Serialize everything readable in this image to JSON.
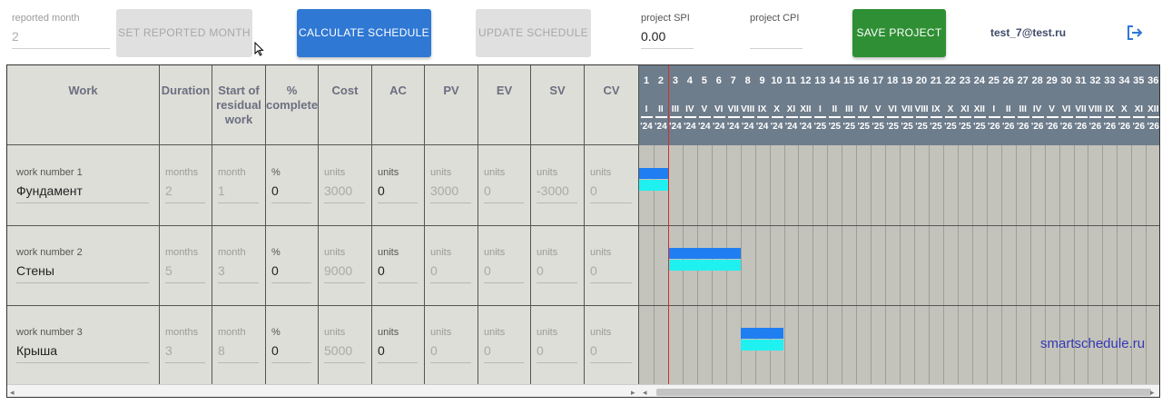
{
  "toolbar": {
    "reported_month_label": "reported month",
    "reported_month_value": "2",
    "set_reported_month": "SET REPORTED MONTH",
    "calculate_schedule": "CALCULATE SCHEDULE",
    "update_schedule": "UPDATE SCHEDULE",
    "spi_label": "project SPI",
    "spi_value": "0.00",
    "cpi_label": "project CPI",
    "cpi_value": "",
    "save_project": "SAVE PROJECT",
    "user_email": "test_7@test.ru"
  },
  "columns": {
    "work": "Work",
    "duration": "Duration",
    "start": "Start of residual work",
    "complete": "% complete",
    "cost": "Cost",
    "ac": "AC",
    "pv": "PV",
    "ev": "EV",
    "sv": "SV",
    "cv": "CV"
  },
  "units": {
    "months": "months",
    "month": "month",
    "percent": "%",
    "units": "units"
  },
  "rows": [
    {
      "label": "work number 1",
      "name": "Фундамент",
      "duration": "2",
      "start": "1",
      "complete": "0",
      "cost": "3000",
      "ac": "0",
      "pv": "3000",
      "ev": "0",
      "sv": "-3000",
      "cv": "0",
      "bar_start": 0,
      "bar_len": 2
    },
    {
      "label": "work number 2",
      "name": "Стены",
      "duration": "5",
      "start": "3",
      "complete": "0",
      "cost": "9000",
      "ac": "0",
      "pv": "0",
      "ev": "0",
      "sv": "0",
      "cv": "0",
      "bar_start": 2,
      "bar_len": 5
    },
    {
      "label": "work number 3",
      "name": "Крыша",
      "duration": "3",
      "start": "8",
      "complete": "0",
      "cost": "5000",
      "ac": "0",
      "pv": "0",
      "ev": "0",
      "sv": "0",
      "cv": "0",
      "bar_start": 7,
      "bar_len": 3
    }
  ],
  "timeline": {
    "months": [
      "1",
      "2",
      "3",
      "4",
      "5",
      "6",
      "7",
      "8",
      "9",
      "10",
      "11",
      "12",
      "13",
      "14",
      "15",
      "16",
      "17",
      "18",
      "19",
      "20",
      "21",
      "22",
      "23",
      "24",
      "25",
      "26",
      "27",
      "28",
      "29",
      "30",
      "31",
      "32",
      "33",
      "34",
      "35",
      "36"
    ],
    "roman": [
      "I",
      "II",
      "III",
      "IV",
      "V",
      "VI",
      "VII",
      "VIII",
      "IX",
      "X",
      "XI",
      "XII",
      "I",
      "II",
      "III",
      "IV",
      "V",
      "VI",
      "VII",
      "VIII",
      "IX",
      "X",
      "XI",
      "XII",
      "I",
      "II",
      "III",
      "IV",
      "V",
      "VI",
      "VII",
      "VIII",
      "IX",
      "X",
      "XI",
      "XII"
    ],
    "years": [
      "'24",
      "'24",
      "'24",
      "'24",
      "'24",
      "'24",
      "'24",
      "'24",
      "'24",
      "'24",
      "'24",
      "'24",
      "'25",
      "'25",
      "'25",
      "'25",
      "'25",
      "'25",
      "'25",
      "'25",
      "'25",
      "'25",
      "'25",
      "'25",
      "'26",
      "'26",
      "'26",
      "'26",
      "'26",
      "'26",
      "'26",
      "'26",
      "'26",
      "'26",
      "'26",
      "'26"
    ]
  },
  "watermark": "smartschedule.ru",
  "colors": {
    "plan_bar": "#1e7ef2",
    "actual_bar": "#1ff0f0",
    "button_blue": "#2f78d4",
    "button_green": "#2f8f34",
    "gantt_header": "#6e7d8c"
  },
  "icons": {
    "logout": "logout-icon",
    "cursor": "mouse-cursor"
  }
}
